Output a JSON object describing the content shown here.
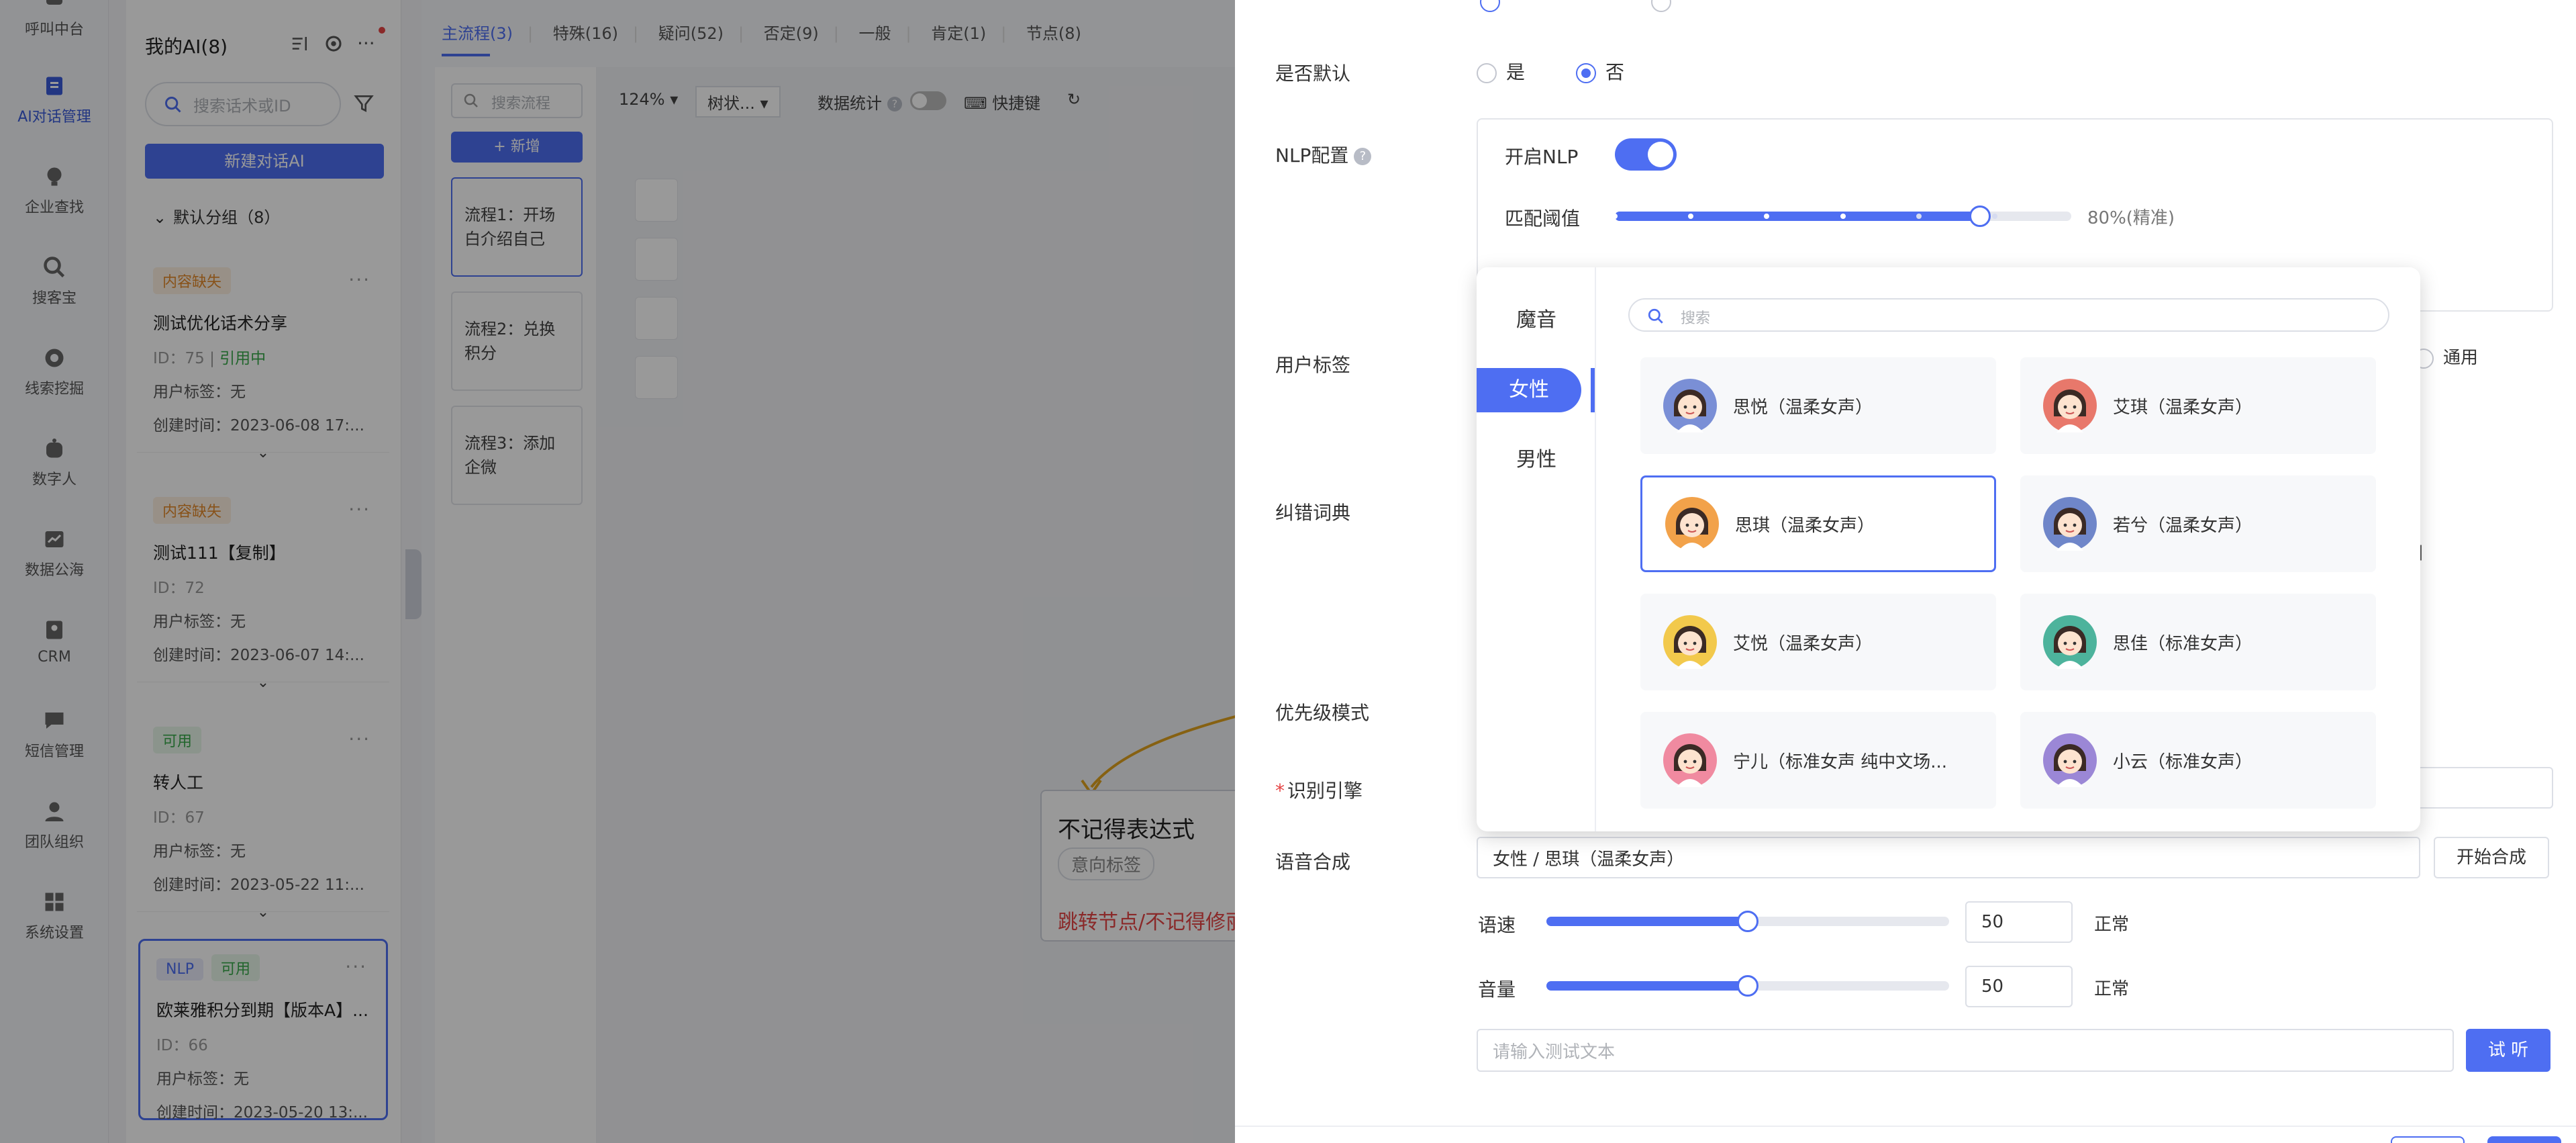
{
  "nav": {
    "items": [
      {
        "label": "呼叫中台",
        "icon": "call-icon"
      },
      {
        "label": "AI对话管理",
        "icon": "ai-dialog-icon",
        "active": true
      },
      {
        "label": "企业查找",
        "icon": "bulb-icon"
      },
      {
        "label": "搜客宝",
        "icon": "search-customer-icon"
      },
      {
        "label": "线索挖掘",
        "icon": "target-icon"
      },
      {
        "label": "数字人",
        "icon": "digital-human-icon"
      },
      {
        "label": "数据公海",
        "icon": "chart-icon"
      },
      {
        "label": "CRM",
        "icon": "crm-icon"
      },
      {
        "label": "短信管理",
        "icon": "sms-icon"
      },
      {
        "label": "团队组织",
        "icon": "team-icon"
      },
      {
        "label": "系统设置",
        "icon": "settings-grid-icon"
      }
    ]
  },
  "ai_list": {
    "title": "我的AI(8)",
    "search_placeholder": "搜索话术或ID",
    "new_button": "新建对话AI",
    "group_label": "默认分组（8）",
    "cards": [
      {
        "badges": [
          "内容缺失"
        ],
        "title": "测试优化话术分享",
        "id_text": "ID：75",
        "status": "引用中",
        "tags": "用户标签：无",
        "created": "创建时间：2023-06-08 17:..."
      },
      {
        "badges": [
          "内容缺失"
        ],
        "title": "测试111【复制】",
        "id_text": "ID：72",
        "status": "",
        "tags": "用户标签：无",
        "created": "创建时间：2023-06-07 14:..."
      },
      {
        "badges": [
          "可用"
        ],
        "title": "转人工",
        "id_text": "ID：67",
        "status": "",
        "tags": "用户标签：无",
        "created": "创建时间：2023-05-22 11:..."
      },
      {
        "badges": [
          "NLP",
          "可用"
        ],
        "title": "欧莱雅积分到期【版本A】...",
        "id_text": "ID：66",
        "status": "",
        "tags": "用户标签：无",
        "created": "创建时间：2023-05-20 13:..."
      }
    ]
  },
  "flow": {
    "tabs": [
      "主流程(3)",
      "特殊(16)",
      "疑问(52)",
      "否定(9)",
      "一般",
      "肯定(1)",
      "节点(8)"
    ],
    "search_placeholder": "搜索流程",
    "add_button": "+ 新增",
    "items": [
      "流程1：开场白介绍自己",
      "流程2：兑换积分",
      "流程3：添加企微"
    ],
    "toolbar": {
      "zoom": "124%",
      "layout": "树状...",
      "stats": "数据统计",
      "shortcut": "快捷键"
    },
    "node": {
      "title": "不记得表达式",
      "tag": "意向标签",
      "jump": "跳转节点/不记得修丽可节点"
    }
  },
  "drawer": {
    "default_label": "是否默认",
    "default_yes": "是",
    "default_no": "否",
    "nlp_label": "NLP配置",
    "nlp_enable": "开启NLP",
    "match_label": "匹配阈值",
    "match_value": "80%(精准)",
    "match_level": 0.8,
    "user_tag_label": "用户标签",
    "user_tag_option": "通用",
    "dict_label": "纠错词典",
    "priority_label": "优先级模式",
    "engine_label": "识别引擎",
    "tts_label": "语音合成",
    "tts_value": "女性 / 思琪（温柔女声）",
    "tts_button": "开始合成",
    "speed_label": "语速",
    "speed_value": "50",
    "speed_text": "正常",
    "speed_level": 0.5,
    "volume_label": "音量",
    "volume_value": "50",
    "volume_text": "正常",
    "volume_level": 0.5,
    "test_placeholder": "请输入测试文本",
    "listen_button": "试 听"
  },
  "voice_picker": {
    "categories": [
      "魔音",
      "女性",
      "男性"
    ],
    "active_category": "女性",
    "search_placeholder": "搜索",
    "voices": [
      {
        "name": "思悦（温柔女声）",
        "selected": false,
        "color": "#7a8fd6"
      },
      {
        "name": "艾琪（温柔女声）",
        "selected": false,
        "color": "#e8786b"
      },
      {
        "name": "思琪（温柔女声）",
        "selected": true,
        "color": "#f2a24a"
      },
      {
        "name": "若兮（温柔女声）",
        "selected": false,
        "color": "#6f86c9"
      },
      {
        "name": "艾悦（温柔女声）",
        "selected": false,
        "color": "#f2c94c"
      },
      {
        "name": "思佳（标准女声）",
        "selected": false,
        "color": "#4db39c"
      },
      {
        "name": "宁儿（标准女声 纯中文场...",
        "selected": false,
        "color": "#f08aa0"
      },
      {
        "name": "小云（标准女声）",
        "selected": false,
        "color": "#9b87d6"
      }
    ]
  }
}
